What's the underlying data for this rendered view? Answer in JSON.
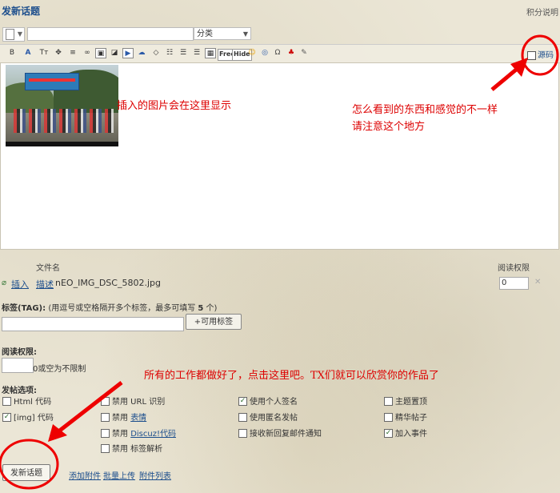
{
  "header": {
    "title": "发新话题",
    "score_help": "积分说明"
  },
  "compose": {
    "subject_value": "",
    "category_selected": "分类"
  },
  "toolbar": {
    "buttons": [
      {
        "name": "bold-icon",
        "glyph": "B"
      },
      {
        "name": "font-color-icon",
        "glyph": "A"
      },
      {
        "name": "font-size-icon",
        "glyph": "Tт"
      },
      {
        "name": "font-color-palette-icon",
        "glyph": "✥"
      },
      {
        "name": "align-icon",
        "glyph": "≡"
      },
      {
        "name": "link-icon",
        "glyph": "∞"
      },
      {
        "name": "image-icon",
        "glyph": "▣"
      },
      {
        "name": "flash-icon",
        "glyph": "◪"
      },
      {
        "name": "media-icon",
        "glyph": "▶"
      },
      {
        "name": "quote-icon",
        "glyph": "☁"
      },
      {
        "name": "code-icon",
        "glyph": "◇"
      },
      {
        "name": "list-icon",
        "glyph": "☷"
      },
      {
        "name": "indent-icon",
        "glyph": "☰"
      },
      {
        "name": "outdent-icon",
        "glyph": "☰"
      },
      {
        "name": "table-icon",
        "glyph": "▦"
      }
    ],
    "free_label": "Free",
    "hide_label": "Hide",
    "extra_icons": [
      {
        "name": "smiley-icon",
        "glyph": "☺"
      },
      {
        "name": "compass-icon",
        "glyph": "◎"
      },
      {
        "name": "special-char-icon",
        "glyph": "Ω"
      },
      {
        "name": "qq-icon",
        "glyph": "♣"
      },
      {
        "name": "wrench-icon",
        "glyph": "✎"
      }
    ],
    "source_label": "源码"
  },
  "annotations": {
    "image_note": "插入的图片会在这里显示",
    "view_note_line1": "怎么看到的东西和感觉的不一样",
    "view_note_line2": "请注意这个地方",
    "submit_note": "所有的工作都做好了，点击这里吧。TX们就可以欣赏你的作品了"
  },
  "attachments": {
    "col_filename": "文件名",
    "col_perm": "阅读权限",
    "rows": [
      {
        "insert": "插入",
        "describe": "描述",
        "filename": "nEO_IMG_DSC_5802.jpg",
        "perm": "0",
        "delete": "✕"
      }
    ]
  },
  "tags": {
    "label": "标签(TAG):",
    "hint": " (用逗号或空格隔开多个标签，最多可填写 ",
    "max": "5",
    "hint_end": " 个)",
    "button": "+可用标签"
  },
  "read_perm": {
    "label": "阅读权限:",
    "hint": "0或空为不限制"
  },
  "post_options": {
    "label": "发帖选项:",
    "col1": [
      {
        "text": "Html 代码",
        "checked": false
      },
      {
        "text": "[img] 代码",
        "checked": true
      }
    ],
    "col2": [
      {
        "text": "禁用  URL 识别",
        "checked": false
      },
      {
        "prefix": "禁用  ",
        "link": "表情",
        "checked": false
      },
      {
        "prefix": "禁用  ",
        "link": "Discuz!代码",
        "checked": false
      },
      {
        "text": "禁用  标签解析",
        "checked": false
      }
    ],
    "col3": [
      {
        "text": "使用个人签名",
        "checked": true
      },
      {
        "text": "使用匿名发帖",
        "checked": false
      },
      {
        "text": "接收新回复邮件通知",
        "checked": false
      }
    ],
    "col4": [
      {
        "text": "主题置顶",
        "checked": false
      },
      {
        "text": "精华帖子",
        "checked": false
      },
      {
        "text": "加入事件",
        "checked": true
      }
    ]
  },
  "footer": {
    "submit": "发新话题",
    "add_attachment": "添加附件",
    "batch_upload": "批量上传",
    "attachment_list": "附件列表"
  },
  "colors": {
    "link": "#1b4d8c",
    "annotation": "#d00",
    "editor_bg": "#ffffff"
  }
}
